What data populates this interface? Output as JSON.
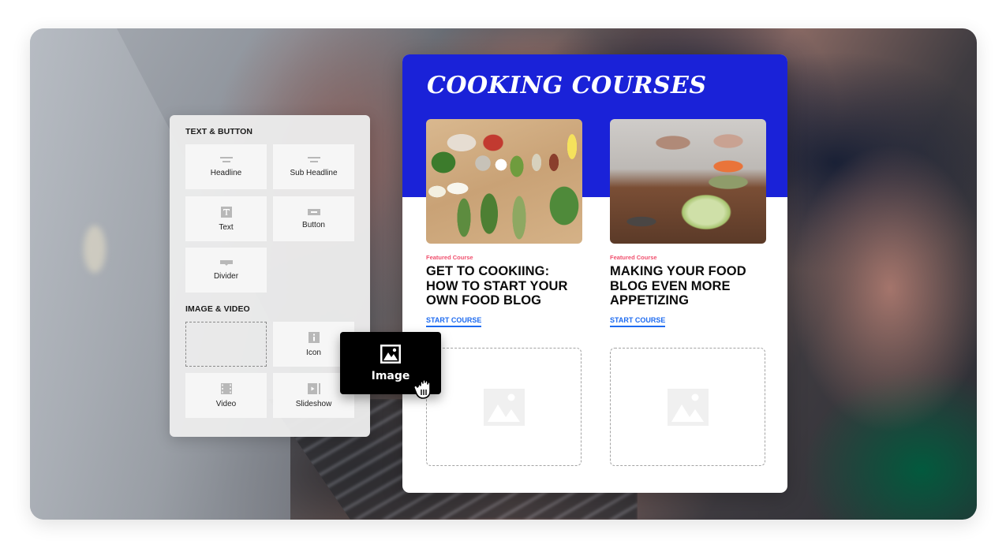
{
  "colors": {
    "brand": "#1a22d8",
    "kicker": "#f0506e",
    "link": "#1e6bf0",
    "drag_ghost": "#000000"
  },
  "panel": {
    "sections": [
      {
        "title": "TEXT & BUTTON",
        "items": [
          {
            "label": "Headline",
            "icon": "headline-icon"
          },
          {
            "label": "Sub Headline",
            "icon": "sub-headline-icon"
          },
          {
            "label": "Text",
            "icon": "text-icon"
          },
          {
            "label": "Button",
            "icon": "button-icon"
          },
          {
            "label": "Divider",
            "icon": "divider-icon"
          }
        ]
      },
      {
        "title": "IMAGE & VIDEO",
        "items": [
          {
            "label": "",
            "icon": "empty-slot",
            "state": "dragging-placeholder"
          },
          {
            "label": "Icon",
            "icon": "info-icon"
          },
          {
            "label": "Video",
            "icon": "film-icon"
          },
          {
            "label": "Slideshow",
            "icon": "slideshow-icon"
          }
        ]
      }
    ]
  },
  "drag_ghost": {
    "label": "Image",
    "icon": "image-icon",
    "cursor": "grab-hand-cursor"
  },
  "template": {
    "title": "COOKING COURSES",
    "courses": [
      {
        "kicker": "Featured Course",
        "title": "GET TO COOKIING: HOW TO START YOUR OWN FOOD BLOG",
        "cta": "START COURSE",
        "photo": "vegetables-on-table-photo"
      },
      {
        "kicker": "Featured Course",
        "title": "MAKING YOUR FOOD BLOG EVEN MORE APPETIZING",
        "cta": "START COURSE",
        "photo": "cabbage-cutting-board-photo"
      }
    ],
    "drop_zones": [
      {
        "icon": "image-placeholder-icon"
      },
      {
        "icon": "image-placeholder-icon"
      }
    ]
  }
}
